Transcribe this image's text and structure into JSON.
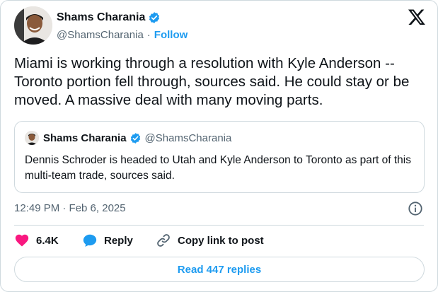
{
  "author": {
    "name": "Shams Charania",
    "handle": "@ShamsCharania",
    "separator": "·",
    "follow_label": "Follow"
  },
  "tweet": {
    "text": "Miami is working through a resolution with Kyle Anderson -- Toronto portion fell through, sources said. He could stay or be moved. A massive deal with many moving parts.",
    "timestamp": "12:49 PM · Feb 6, 2025"
  },
  "quote": {
    "name": "Shams Charania",
    "handle": "@ShamsCharania",
    "text": "Dennis Schroder is headed to Utah and Kyle Anderson to Toronto as part of this multi-team trade, sources said."
  },
  "actions": {
    "likes": "6.4K",
    "reply_label": "Reply",
    "copy_label": "Copy link to post"
  },
  "read_replies_label": "Read 447 replies",
  "colors": {
    "accent": "#1d9bf0",
    "like": "#f91880",
    "text": "#0f1419",
    "secondary": "#536471",
    "border": "#cfd9de"
  },
  "icons": [
    "verified-badge-icon",
    "x-logo-icon",
    "info-icon",
    "heart-icon",
    "reply-bubble-icon",
    "link-icon"
  ]
}
